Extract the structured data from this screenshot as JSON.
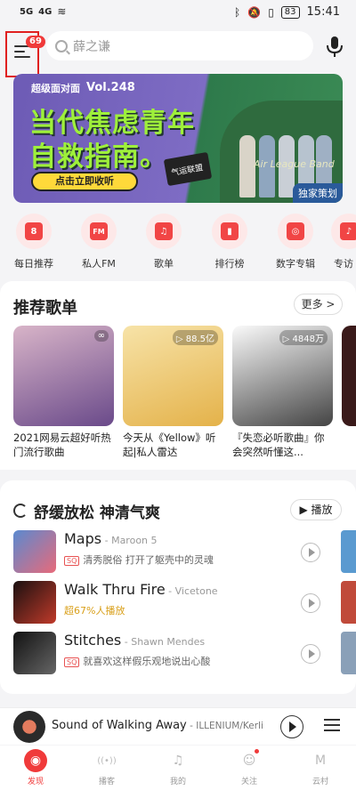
{
  "status_bar": {
    "signal1": "5G",
    "signal2": "4G",
    "battery": "83",
    "time": "15:41"
  },
  "header": {
    "menu_badge": "69",
    "search_placeholder": "薛之谦"
  },
  "banner": {
    "logo": "超级面对面",
    "vol": "Vol.248",
    "headline_1": "当代焦虑青年",
    "headline_2": "自救指南。",
    "cta": "点击立即收听",
    "clapper_text": "气运联盟",
    "script_text": "Air League Band",
    "exclusive": "独家策划"
  },
  "quick_entries": [
    {
      "label": "每日推荐",
      "icon": "calendar-icon",
      "glyph": "8"
    },
    {
      "label": "私人FM",
      "icon": "radio-icon",
      "glyph": "FM"
    },
    {
      "label": "歌单",
      "icon": "playlist-icon",
      "glyph": "♫"
    },
    {
      "label": "排行榜",
      "icon": "chart-icon",
      "glyph": "▮"
    },
    {
      "label": "数字专辑",
      "icon": "album-icon",
      "glyph": "◎"
    },
    {
      "label": "专访",
      "icon": "interview-icon",
      "glyph": "♪"
    }
  ],
  "recommend": {
    "title": "推荐歌单",
    "more": "更多 >",
    "playlists": [
      {
        "title": "2021网易云超好听热门流行歌曲",
        "count": "",
        "color1": "#c9a0b8",
        "color2": "#5b3a7a"
      },
      {
        "title": "今天从《Yellow》听起|私人雷达",
        "count": "88.5亿",
        "color1": "#f3d27a",
        "color2": "#e0a83a"
      },
      {
        "title": "『失恋必听歌曲』你会突然听懂这...",
        "count": "4848万",
        "color1": "#f0f0f0",
        "color2": "#333333"
      }
    ]
  },
  "relax": {
    "title": "舒缓放松 神清气爽",
    "play": "▶ 播放",
    "songs": [
      {
        "name": "Maps",
        "artist": " - Maroon 5",
        "tag": "SQ",
        "sub": "清秀脱俗 打开了躯壳中的灵魂",
        "gold": false,
        "c1": "#3a6fb5",
        "c2": "#e85a6a"
      },
      {
        "name": "Walk Thru Fire",
        "artist": " - Vicetone",
        "tag": "",
        "sub": "超67%人播放",
        "gold": true,
        "c1": "#2a1a1a",
        "c2": "#c03a2a"
      },
      {
        "name": "Stitches",
        "artist": " - Shawn Mendes",
        "tag": "SQ",
        "sub": "就喜欢这样假乐观地说出心酸",
        "gold": false,
        "c1": "#111111",
        "c2": "#555555"
      }
    ]
  },
  "player": {
    "title": "Sound of Walking Away",
    "artist": " - ILLENIUM/Kerli"
  },
  "nav": [
    {
      "label": "发现",
      "icon": "discover-icon",
      "glyph": "◉",
      "active": true
    },
    {
      "label": "播客",
      "icon": "podcast-icon",
      "glyph": "((•))",
      "active": false
    },
    {
      "label": "我的",
      "icon": "music-icon",
      "glyph": "♫",
      "active": false
    },
    {
      "label": "关注",
      "icon": "follow-icon",
      "glyph": "☺",
      "active": false
    },
    {
      "label": "云村",
      "icon": "cloud-village-icon",
      "glyph": "M",
      "active": false
    }
  ]
}
